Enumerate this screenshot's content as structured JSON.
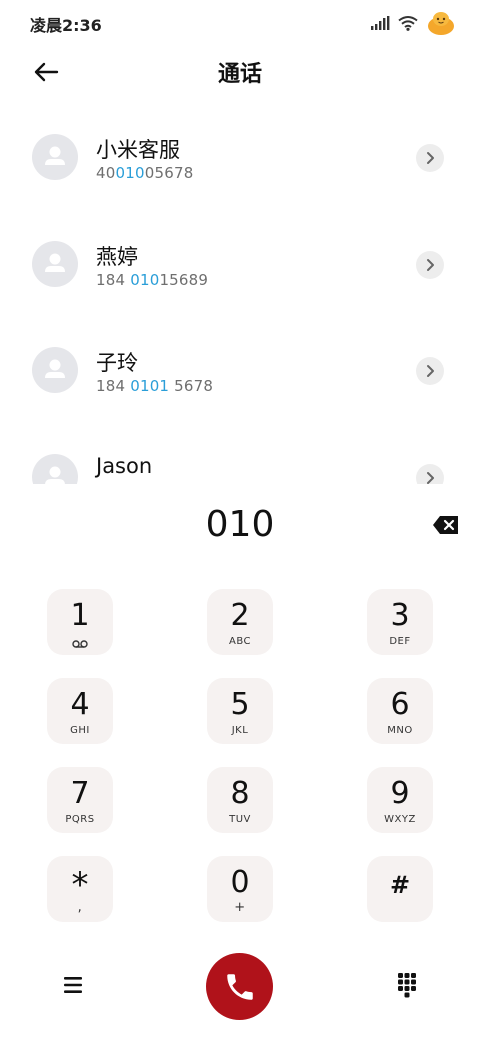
{
  "status_bar": {
    "time": "凌晨2:36",
    "icons": [
      "signal-icon",
      "wifi-icon",
      "mascot-icon"
    ]
  },
  "header": {
    "title": "通话",
    "back_icon": "back-arrow-icon"
  },
  "contacts": [
    {
      "name": "小米客服",
      "number_pre": "40",
      "number_hl": "010",
      "number_post": "05678"
    },
    {
      "name": "燕婷",
      "number_pre": "184 ",
      "number_hl": "010",
      "number_post": "15689"
    },
    {
      "name": "子玲",
      "number_pre": "184 ",
      "number_hl": "0101",
      "number_post": " 5678"
    },
    {
      "name": "Jason",
      "number_pre": "",
      "number_hl": "",
      "number_post": ""
    }
  ],
  "dialer": {
    "number": "010",
    "backspace_icon": "backspace-icon"
  },
  "keypad": {
    "keys": [
      {
        "digit": "1",
        "letters": "",
        "icon": "voicemail-icon"
      },
      {
        "digit": "2",
        "letters": "ABC"
      },
      {
        "digit": "3",
        "letters": "DEF"
      },
      {
        "digit": "4",
        "letters": "GHI"
      },
      {
        "digit": "5",
        "letters": "JKL"
      },
      {
        "digit": "6",
        "letters": "MNO"
      },
      {
        "digit": "7",
        "letters": "PQRS"
      },
      {
        "digit": "8",
        "letters": "TUV"
      },
      {
        "digit": "9",
        "letters": "WXYZ"
      },
      {
        "digit": "*",
        "letters": ","
      },
      {
        "digit": "0",
        "letters": "+"
      },
      {
        "digit": "#",
        "letters": ""
      }
    ]
  },
  "bottom_bar": {
    "menu_icon": "menu-icon",
    "call_icon": "phone-icon",
    "keypad_icon": "dialpad-icon"
  },
  "colors": {
    "highlight": "#2a9ed8",
    "call_button": "#b0121a",
    "key_background": "#f6f2f1"
  }
}
